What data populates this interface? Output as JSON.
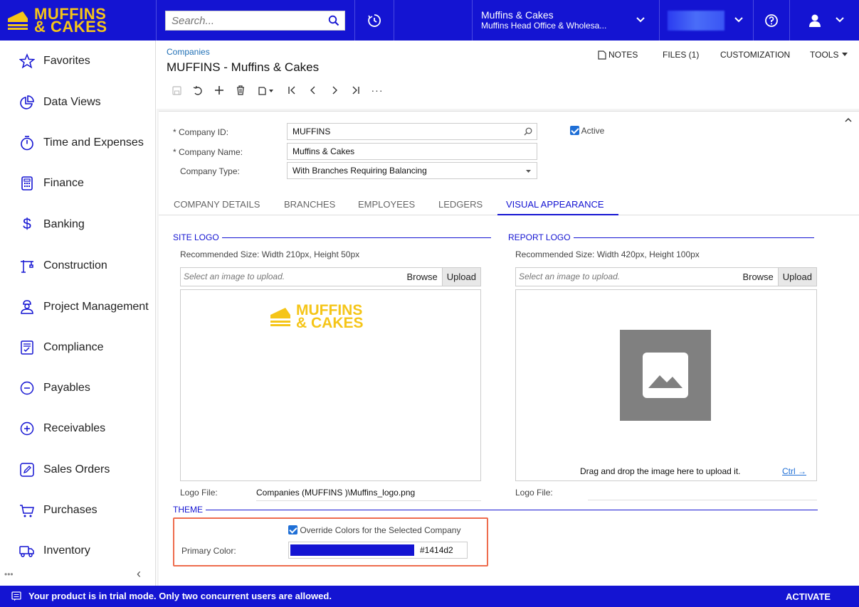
{
  "brand": {
    "logo_line1": "MUFFINS",
    "logo_line2": "& CAKES"
  },
  "topbar": {
    "search_placeholder": "Search...",
    "company_name": "Muffins & Cakes",
    "company_branch": "Muffins Head Office & Wholesa...",
    "colors": {
      "bar": "#1414d2",
      "logo": "#f5c518"
    }
  },
  "sidebar": {
    "items": [
      {
        "label": "Favorites",
        "icon": "star-icon"
      },
      {
        "label": "Data Views",
        "icon": "pie-chart-icon"
      },
      {
        "label": "Time and Expenses",
        "icon": "stopwatch-icon"
      },
      {
        "label": "Finance",
        "icon": "calculator-icon"
      },
      {
        "label": "Banking",
        "icon": "dollar-icon"
      },
      {
        "label": "Construction",
        "icon": "crane-icon"
      },
      {
        "label": "Project Management",
        "icon": "worker-icon"
      },
      {
        "label": "Compliance",
        "icon": "checklist-icon"
      },
      {
        "label": "Payables",
        "icon": "minus-circle-icon"
      },
      {
        "label": "Receivables",
        "icon": "plus-circle-icon"
      },
      {
        "label": "Sales Orders",
        "icon": "pencil-square-icon"
      },
      {
        "label": "Purchases",
        "icon": "cart-icon"
      },
      {
        "label": "Inventory",
        "icon": "truck-icon"
      }
    ],
    "more": "•••",
    "collapse": "‹"
  },
  "header": {
    "breadcrumb": "Companies",
    "title": "MUFFINS - Muffins & Cakes",
    "notes": "NOTES",
    "files": "FILES (1)",
    "customization": "CUSTOMIZATION",
    "tools": "TOOLS"
  },
  "form": {
    "company_id_label": "Company ID:",
    "company_id": "MUFFINS",
    "active_label": "Active",
    "company_name_label": "Company Name:",
    "company_name": "Muffins & Cakes",
    "company_type_label": "Company Type:",
    "company_type": "With Branches Requiring Balancing"
  },
  "tabs": [
    "COMPANY DETAILS",
    "BRANCHES",
    "EMPLOYEES",
    "LEDGERS",
    "VISUAL APPEARANCE"
  ],
  "site_logo": {
    "title": "SITE LOGO",
    "recommended": "Recommended Size: Width 210px, Height 50px",
    "placeholder": "Select an image to upload.",
    "browse": "Browse",
    "upload": "Upload",
    "logo_file_label": "Logo File:",
    "logo_file": "Companies (MUFFINS   )\\Muffins_logo.png"
  },
  "report_logo": {
    "title": "REPORT LOGO",
    "recommended": "Recommended Size: Width 420px, Height 100px",
    "placeholder": "Select an image to upload.",
    "browse": "Browse",
    "upload": "Upload",
    "drag_drop": "Drag and drop the image here to upload it.",
    "ctrl": "Ctrl →",
    "logo_file_label": "Logo File:"
  },
  "theme": {
    "title": "THEME",
    "override_label": "Override Colors for the Selected Company",
    "primary_color_label": "Primary Color:",
    "primary_color_value": "#1414d2"
  },
  "status": {
    "message": "Your product is in trial mode. Only two concurrent users are allowed.",
    "activate": "ACTIVATE"
  }
}
